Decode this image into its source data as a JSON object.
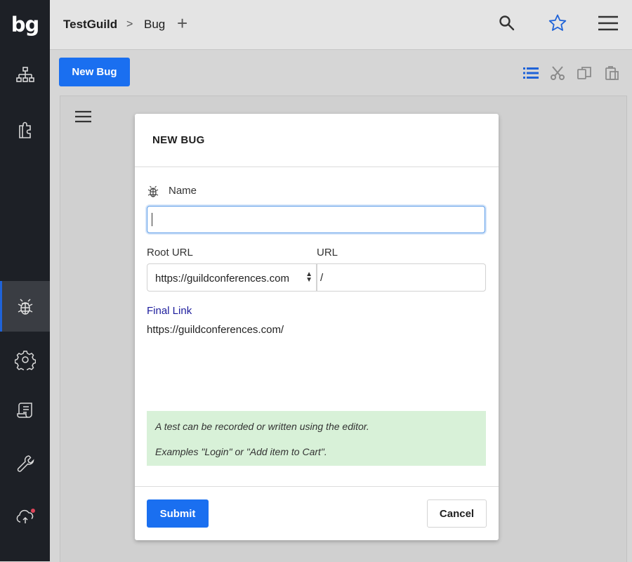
{
  "app": {
    "logo_text": "bg"
  },
  "breadcrumb": {
    "project": "TestGuild",
    "separator": ">",
    "page": "Bug",
    "add_symbol": "+"
  },
  "header_icons": [
    "search-icon",
    "star-icon",
    "menu-icon"
  ],
  "sidebar": {
    "items": [
      {
        "name": "sitemap-icon"
      },
      {
        "name": "puzzle-icon"
      },
      {
        "name": "bug-icon",
        "active": true
      },
      {
        "name": "gear-icon"
      },
      {
        "name": "script-icon"
      },
      {
        "name": "wrench-icon"
      },
      {
        "name": "cloud-sync-icon",
        "badge": true
      }
    ]
  },
  "toolbar": {
    "new_button_label": "New Bug",
    "icons": [
      "list-icon",
      "cut-icon",
      "copy-icon",
      "paste-icon"
    ]
  },
  "modal": {
    "title": "NEW BUG",
    "name_label": "Name",
    "name_value": "",
    "root_url_label": "Root URL",
    "root_url_value": "https://guildconferences.com",
    "url_label": "URL",
    "url_value": "/",
    "final_link_label": "Final Link",
    "final_link_value": "https://guildconferences.com/",
    "hint_line1": "A test can be recorded or written using the editor.",
    "hint_line2": "Examples \"Login\" or \"Add item to Cart\".",
    "submit_label": "Submit",
    "cancel_label": "Cancel"
  },
  "colors": {
    "accent": "#1a6ff0",
    "sidebar_bg": "#1d2026",
    "hint_bg": "#d8f1d8",
    "link": "#1c1c9c",
    "badge": "#e0455a",
    "star": "#1f63d8"
  }
}
